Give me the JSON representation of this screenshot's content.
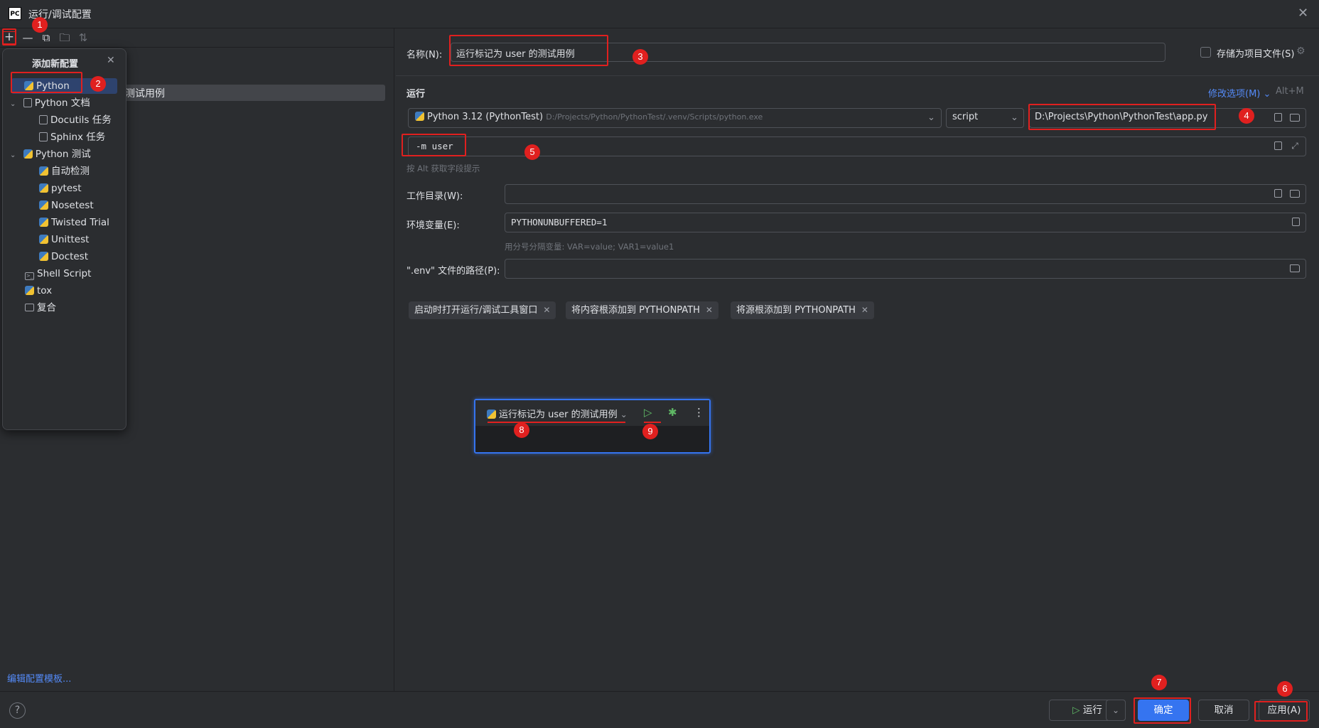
{
  "window": {
    "title": "运行/调试配置",
    "logo": "PC"
  },
  "toolbar": {
    "icons": [
      "add-icon",
      "remove-icon",
      "copy-icon",
      "folder-icon",
      "sort-icon"
    ]
  },
  "left": {
    "existing_config_label": "测试用例",
    "edit_templates": "编辑配置模板..."
  },
  "popup": {
    "title": "添加新配置",
    "items": [
      {
        "label": "Python",
        "icon": "python-icon"
      },
      {
        "label": "Python 文档",
        "icon": "python-doc-icon"
      },
      {
        "label": "Docutils 任务",
        "icon": "doc-icon"
      },
      {
        "label": "Sphinx 任务",
        "icon": "doc-icon"
      },
      {
        "label": "Python 测试",
        "icon": "python-icon"
      },
      {
        "label": "自动检测",
        "icon": "python-test-icon"
      },
      {
        "label": "pytest",
        "icon": "python-test-icon"
      },
      {
        "label": "Nosetest",
        "icon": "python-test-icon"
      },
      {
        "label": "Twisted Trial",
        "icon": "python-test-icon"
      },
      {
        "label": "Unittest",
        "icon": "python-test-icon"
      },
      {
        "label": "Doctest",
        "icon": "python-test-icon"
      },
      {
        "label": "Shell Script",
        "icon": "shell-icon"
      },
      {
        "label": "tox",
        "icon": "python-icon"
      },
      {
        "label": "复合",
        "icon": "compound-icon"
      }
    ]
  },
  "form": {
    "name_label": "名称(N):",
    "name_value": "运行标记为 user 的测试用例",
    "store_as_file": "存储为项目文件(S)",
    "run_section": "运行",
    "modify_options": "修改选项(M)",
    "modify_shortcut": "Alt+M",
    "interpreter_name": "Python 3.12 (PythonTest)",
    "interpreter_path": "D:/Projects/Python/PythonTest/.venv/Scripts/python.exe",
    "target_type": "script",
    "script_path": "D:\\Projects\\Python\\PythonTest\\app.py",
    "params_value": "-m user",
    "params_hint": "按 Alt 获取字段提示",
    "workdir_label": "工作目录(W):",
    "workdir_value": "",
    "env_label": "环境变量(E):",
    "env_value": "PYTHONUNBUFFERED=1",
    "env_hint": "用分号分隔变量: VAR=value; VAR1=value1",
    "dotenv_label": "\".env\" 文件的路径(P):",
    "dotenv_value": "",
    "chips": [
      "启动时打开运行/调试工具窗口",
      "将内容根添加到 PYTHONPATH",
      "将源根添加到 PYTHONPATH"
    ]
  },
  "run_widget": {
    "config_name": "运行标记为 user 的测试用例"
  },
  "buttons": {
    "run": "运行",
    "ok": "确定",
    "cancel": "取消",
    "apply": "应用(A)"
  },
  "annotations": [
    "1",
    "2",
    "3",
    "4",
    "5",
    "6",
    "7",
    "8",
    "9"
  ],
  "colors": {
    "accent": "#3574f0",
    "annotation": "#e0201f",
    "background": "#2b2d30",
    "link": "#548af7"
  }
}
